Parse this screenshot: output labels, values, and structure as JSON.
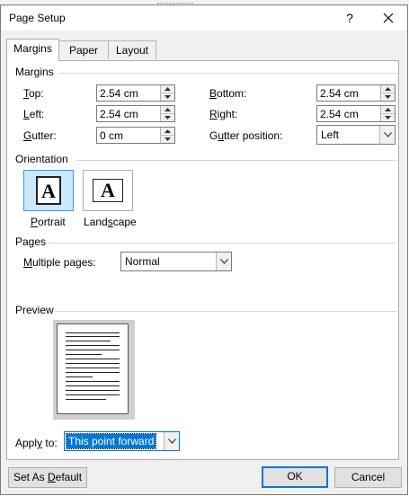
{
  "window": {
    "title": "Page Setup",
    "help": "?"
  },
  "tabs": [
    {
      "label": "Margins"
    },
    {
      "label": "Paper"
    },
    {
      "label": "Layout"
    }
  ],
  "margins": {
    "heading": "Margins",
    "top": {
      "label": "Top:",
      "value": "2.54 cm"
    },
    "left": {
      "label": "Left:",
      "value": "2.54 cm"
    },
    "gutter": {
      "label": "Gutter:",
      "value": "0 cm"
    },
    "bottom": {
      "label": "Bottom:",
      "value": "2.54 cm"
    },
    "right": {
      "label": "Right:",
      "value": "2.54 cm"
    },
    "gutter_position": {
      "label": "Gutter position:",
      "value": "Left"
    }
  },
  "orientation": {
    "heading": "Orientation",
    "portrait": {
      "label": "Portrait",
      "glyph": "A",
      "selected": true
    },
    "landscape": {
      "label": "Landscape",
      "glyph": "A",
      "selected": false
    }
  },
  "pages": {
    "heading": "Pages",
    "multiple_label": "Multiple pages:",
    "multiple_value": "Normal"
  },
  "preview": {
    "heading": "Preview"
  },
  "apply": {
    "label": "Apply to:",
    "value": "This point forward"
  },
  "footer": {
    "default_button": "Set As Default",
    "ok": "OK",
    "cancel": "Cancel"
  },
  "colors": {
    "accent": "#0078d7",
    "selection": "#cce8ff",
    "dialog_bg": "#f0f0f0"
  },
  "icons": {
    "help": "question-mark",
    "close": "x-close",
    "spin_up": "triangle-up",
    "spin_down": "triangle-down",
    "dropdown": "chevron-down"
  }
}
